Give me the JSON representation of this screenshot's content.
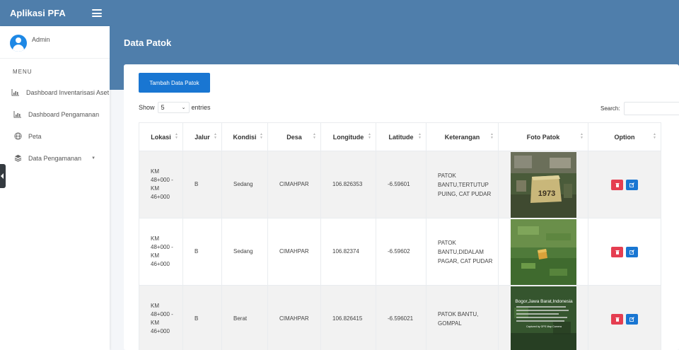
{
  "app": {
    "brand": "Aplikasi PFA"
  },
  "sidebar": {
    "user": "Admin",
    "menu_header": "MENU",
    "items": [
      {
        "label": "Dashboard Inventarisasi Aset",
        "icon": "bar-chart-icon"
      },
      {
        "label": "Dashboard Pengamanan",
        "icon": "bar-chart-icon"
      },
      {
        "label": "Peta",
        "icon": "globe-icon"
      },
      {
        "label": "Data Pengamanan",
        "icon": "layers-icon"
      }
    ]
  },
  "page": {
    "title": "Data Patok"
  },
  "toolbar": {
    "add_label": "Tambah Data Patok",
    "show_label": "Show",
    "entries_value": "5",
    "entries_label": "entries",
    "search_label": "Search:"
  },
  "table": {
    "headers": [
      "Lokasi",
      "Jalur",
      "Kondisi",
      "Desa",
      "Longitude",
      "Latitude",
      "Keterangan",
      "Foto Patok",
      "Option"
    ],
    "rows": [
      {
        "lokasi": "KM 48+000 - KM 46+000",
        "jalur": "B",
        "kondisi": "Sedang",
        "desa": "CIMAHPAR",
        "longitude": "106.826353",
        "latitude": "-6.59601",
        "keterangan": "PATOK BANTU,TERTUTUP PUING, CAT PUDAR"
      },
      {
        "lokasi": "KM 48+000 - KM 46+000",
        "jalur": "B",
        "kondisi": "Sedang",
        "desa": "CIMAHPAR",
        "longitude": "106.82374",
        "latitude": "-6.59602",
        "keterangan": "PATOK BANTU,DIDALAM PAGAR, CAT PUDAR"
      },
      {
        "lokasi": "KM 48+000 - KM 46+000",
        "jalur": "B",
        "kondisi": "Berat",
        "desa": "CIMAHPAR",
        "longitude": "106.826415",
        "latitude": "-6.596021",
        "keterangan": "PATOK BANTU, GOMPAL"
      }
    ],
    "photos": {
      "photo1_marker": "1973",
      "photo3_caption": "Bogor,Jawa Barat,Indonesia",
      "photo3_footer": "Captured by GPS Map Camera"
    }
  },
  "colors": {
    "navbar": "#4f7eab",
    "primary": "#1976d2",
    "danger": "#e53e51"
  }
}
